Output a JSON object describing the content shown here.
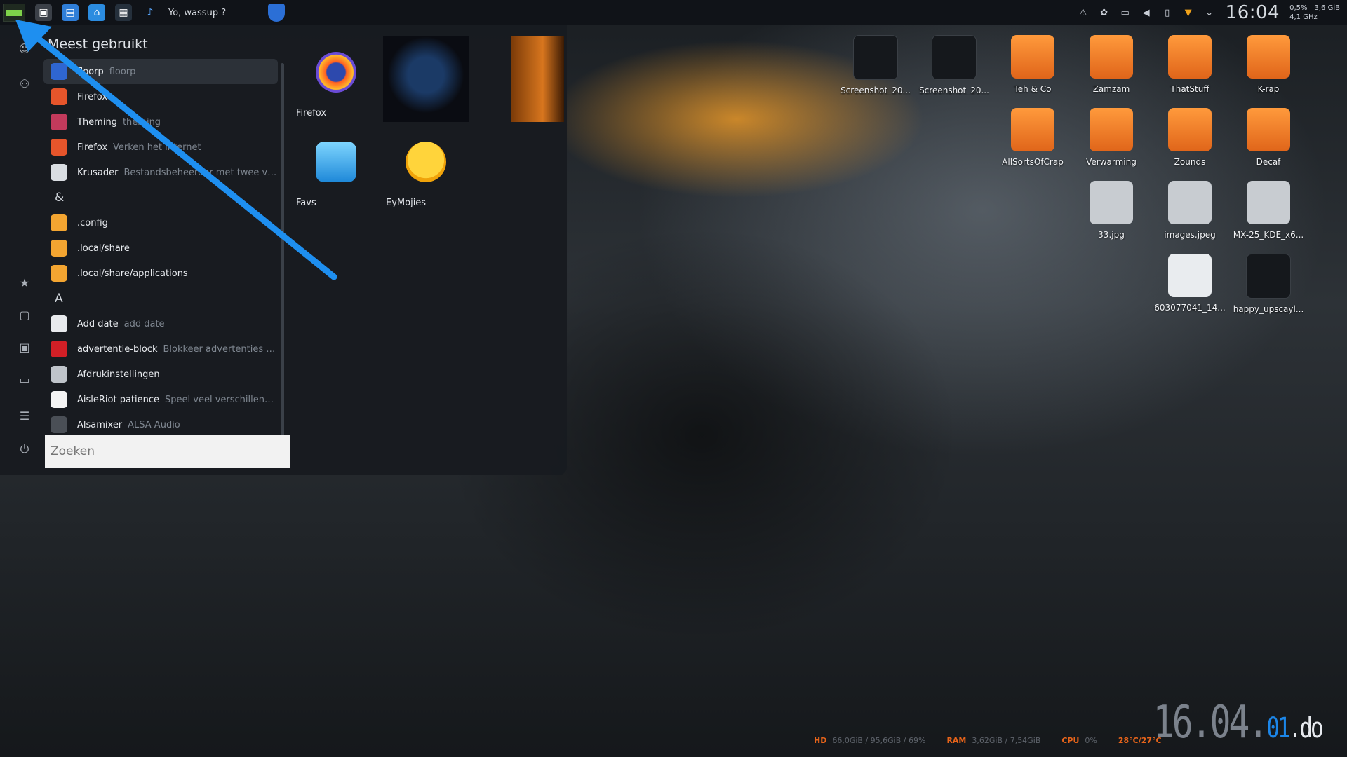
{
  "panel": {
    "text": "Yo, wassup ?",
    "clock": "16:04",
    "cpu_pct": "0,5%",
    "mem": "3,6 GiB",
    "freq": "4,1 GHz"
  },
  "menu": {
    "header": "Meest gebruikt",
    "items": [
      {
        "name": "floorp",
        "desc": "floorp",
        "icon": "floorp-icon",
        "color": "#2f66d1"
      },
      {
        "name": "Firefox",
        "desc": "",
        "icon": "firefox-icon",
        "color": "#e6552b"
      },
      {
        "name": "Theming",
        "desc": "theming",
        "icon": "theming-icon",
        "color": "#c33a5c"
      },
      {
        "name": "Firefox",
        "desc": "Verken het internet",
        "icon": "firefox-icon",
        "color": "#e6552b"
      },
      {
        "name": "Krusader",
        "desc": "Bestandsbeheerder met twee ven...",
        "icon": "krusader-icon",
        "color": "#d9dde2"
      },
      {
        "letter": "&"
      },
      {
        "name": ".config",
        "desc": "",
        "icon": "folder-icon",
        "color": "#f3a531"
      },
      {
        "name": ".local/share",
        "desc": "",
        "icon": "folder-icon",
        "color": "#f3a531"
      },
      {
        "name": ".local/share/applications",
        "desc": "",
        "icon": "folder-icon",
        "color": "#f3a531"
      },
      {
        "letter": "A"
      },
      {
        "name": "Add date",
        "desc": "add date",
        "icon": "document-icon",
        "color": "#e8eaed"
      },
      {
        "name": "advertentie-block",
        "desc": "Blokkeer advertenties mi...",
        "icon": "no-entry-icon",
        "color": "#d21f26"
      },
      {
        "name": "Afdrukinstellingen",
        "desc": "",
        "icon": "printer-icon",
        "color": "#bfc4ca"
      },
      {
        "name": "AisleRiot patience",
        "desc": "Speel veel verschillende s...",
        "icon": "cards-icon",
        "color": "#f4f4f4"
      },
      {
        "name": "Alsamixer",
        "desc": "ALSA Audio",
        "icon": "mixer-icon",
        "color": "#4a4f56"
      }
    ],
    "search_placeholder": "Zoeken",
    "favorites": [
      {
        "label": "Firefox"
      },
      {
        "label": "Favs"
      },
      {
        "label": "EyMojies"
      }
    ]
  },
  "desktop": [
    {
      "label": "Screenshot_20...",
      "icon": "screenshot-thumb",
      "kind": "shot"
    },
    {
      "label": "Screenshot_20...",
      "icon": "screenshot-thumb",
      "kind": "shot"
    },
    {
      "label": "Teh & Co",
      "icon": "folder-icon",
      "kind": "orange"
    },
    {
      "label": "Zamzam",
      "icon": "folder-icon",
      "kind": "orange"
    },
    {
      "label": "ThatStuff",
      "icon": "folder-icon",
      "kind": "orange"
    },
    {
      "label": "K-rap",
      "icon": "folder-icon",
      "kind": "orange"
    },
    {
      "label": "AllSortsOfCrap",
      "icon": "folder-icon",
      "kind": "orange"
    },
    {
      "label": "Verwarming",
      "icon": "folder-icon",
      "kind": "orange"
    },
    {
      "label": "Zounds",
      "icon": "folder-icon",
      "kind": "orange"
    },
    {
      "label": "Decaf",
      "icon": "folder-icon",
      "kind": "orange"
    },
    {
      "label": "33.jpg",
      "icon": "image-thumb",
      "kind": "grey"
    },
    {
      "label": "images.jpeg",
      "icon": "image-thumb",
      "kind": "grey"
    },
    {
      "label": "MX-25_KDE_x6...",
      "icon": "disc-image-icon",
      "kind": "grey"
    },
    {
      "label": "603077041_14...",
      "icon": "document-thumb",
      "kind": "file"
    },
    {
      "label": "happy_upscayl...",
      "icon": "image-thumb",
      "kind": "shot"
    }
  ],
  "stats": {
    "hd_label": "HD",
    "hd_value": "66,0GiB / 95,6GiB / 69%",
    "ram_label": "RAM",
    "ram_value": "3,62GiB / 7,54GiB",
    "cpu_label": "CPU",
    "cpu_value": "0%",
    "temp": "28°C/27°C"
  },
  "bigclock": {
    "main": "16.04.",
    "sec": "01",
    "day": ".do"
  }
}
